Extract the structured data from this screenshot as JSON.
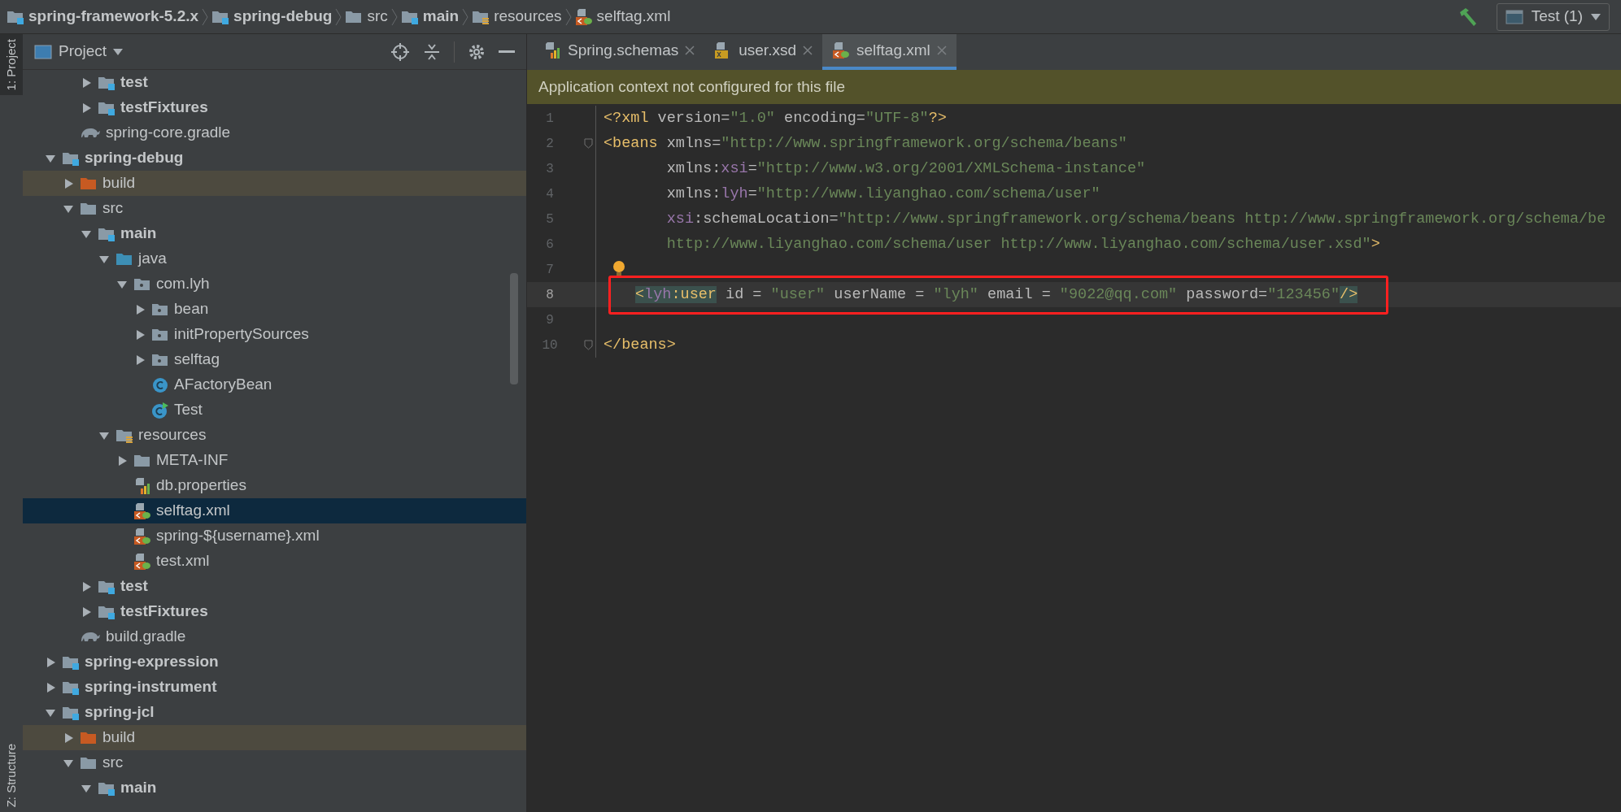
{
  "breadcrumbs": [
    {
      "label": "spring-framework-5.2.x",
      "kind": "module"
    },
    {
      "label": "spring-debug",
      "kind": "module"
    },
    {
      "label": "src",
      "kind": "folder"
    },
    {
      "label": "main",
      "kind": "module"
    },
    {
      "label": "resources",
      "kind": "resources"
    },
    {
      "label": "selftag.xml",
      "kind": "xml-spring"
    }
  ],
  "run_config": {
    "label": "Test (1)"
  },
  "side_tabs": [
    {
      "label": "1: Project",
      "selected": true
    },
    {
      "label": "Z: Structure",
      "selected": false
    }
  ],
  "project_panel": {
    "title": "Project"
  },
  "tree": [
    {
      "kind": "offscreen",
      "children": [
        {
          "kind": "offscreen",
          "children": [
            {
              "label": "test",
              "kind": "module",
              "expanded": false,
              "selected": false
            },
            {
              "label": "testFixtures",
              "kind": "module",
              "expanded": false,
              "selected": false
            }
          ]
        },
        {
          "label": "spring-core.gradle",
          "kind": "gradle",
          "selected": false
        }
      ]
    },
    {
      "label": "spring-debug",
      "kind": "module",
      "expanded": true,
      "selected": false,
      "children": [
        {
          "label": "build",
          "kind": "excluded",
          "expanded": false,
          "selected": false
        },
        {
          "label": "src",
          "kind": "folder",
          "expanded": true,
          "selected": false,
          "children": [
            {
              "label": "main",
              "kind": "module",
              "expanded": true,
              "selected": false,
              "children": [
                {
                  "label": "java",
                  "kind": "source",
                  "expanded": true,
                  "selected": false,
                  "children": [
                    {
                      "label": "com.lyh",
                      "kind": "package",
                      "expanded": true,
                      "selected": false,
                      "children": [
                        {
                          "label": "bean",
                          "kind": "package",
                          "expanded": false,
                          "selected": false
                        },
                        {
                          "label": "initPropertySources",
                          "kind": "package",
                          "expanded": false,
                          "selected": false
                        },
                        {
                          "label": "selftag",
                          "kind": "package",
                          "expanded": false,
                          "selected": false
                        },
                        {
                          "label": "AFactoryBean",
                          "kind": "class",
                          "selected": false
                        },
                        {
                          "label": "Test",
                          "kind": "test-class",
                          "selected": false
                        }
                      ]
                    }
                  ]
                },
                {
                  "label": "resources",
                  "kind": "resources",
                  "expanded": true,
                  "selected": false,
                  "children": [
                    {
                      "label": "META-INF",
                      "kind": "folder",
                      "expanded": false,
                      "selected": false
                    },
                    {
                      "label": "db.properties",
                      "kind": "properties",
                      "selected": false
                    },
                    {
                      "label": "selftag.xml",
                      "kind": "xml-spring",
                      "selected": true
                    },
                    {
                      "label": "spring-${username}.xml",
                      "kind": "xml-spring",
                      "selected": false
                    },
                    {
                      "label": "test.xml",
                      "kind": "xml-spring",
                      "selected": false
                    }
                  ]
                }
              ]
            },
            {
              "label": "test",
              "kind": "module",
              "expanded": false,
              "selected": false
            },
            {
              "label": "testFixtures",
              "kind": "module",
              "expanded": false,
              "selected": false
            }
          ]
        },
        {
          "label": "build.gradle",
          "kind": "gradle",
          "selected": false
        }
      ]
    },
    {
      "label": "spring-expression",
      "kind": "module",
      "expanded": false,
      "selected": false
    },
    {
      "label": "spring-instrument",
      "kind": "module",
      "expanded": false,
      "selected": false
    },
    {
      "label": "spring-jcl",
      "kind": "module",
      "expanded": true,
      "selected": false,
      "children": [
        {
          "label": "build",
          "kind": "excluded",
          "expanded": false,
          "selected": false
        },
        {
          "label": "src",
          "kind": "folder",
          "expanded": true,
          "selected": false,
          "children": [
            {
              "label": "main",
              "kind": "module",
              "expanded": true,
              "selected": false
            }
          ]
        }
      ]
    }
  ],
  "editor_tabs": [
    {
      "label": "Spring.schemas",
      "kind": "properties",
      "selected": false
    },
    {
      "label": "user.xsd",
      "kind": "xsd",
      "selected": false
    },
    {
      "label": "selftag.xml",
      "kind": "xml-spring",
      "selected": true
    }
  ],
  "notification": "Application context not configured for this file",
  "code_lines": [
    {
      "number": "1",
      "tokens": [
        {
          "kind": "tag",
          "text": "<?xml"
        },
        {
          "kind": "attr",
          "text": " version="
        },
        {
          "kind": "value",
          "text": "\"1.0\""
        },
        {
          "kind": "attr",
          "text": " encoding="
        },
        {
          "kind": "value",
          "text": "\"UTF-8\""
        },
        {
          "kind": "tag",
          "text": "?>"
        }
      ]
    },
    {
      "number": "2",
      "fold": true,
      "tokens": [
        {
          "kind": "tag",
          "text": "<beans"
        },
        {
          "kind": "attr",
          "text": " xmlns="
        },
        {
          "kind": "value",
          "text": "\"http://www.springframework.org/schema/beans\""
        }
      ]
    },
    {
      "number": "3",
      "tokens": [
        {
          "kind": "attr",
          "text": "       xmlns:"
        },
        {
          "kind": "ns",
          "text": "xsi"
        },
        {
          "kind": "attr",
          "text": "="
        },
        {
          "kind": "value",
          "text": "\"http://www.w3.org/2001/XMLSchema-instance\""
        }
      ]
    },
    {
      "number": "4",
      "tokens": [
        {
          "kind": "attr",
          "text": "       xmlns:"
        },
        {
          "kind": "ns",
          "text": "lyh"
        },
        {
          "kind": "attr",
          "text": "="
        },
        {
          "kind": "value",
          "text": "\"http://www.liyanghao.com/schema/user\""
        }
      ]
    },
    {
      "number": "5",
      "tokens": [
        {
          "kind": "ns",
          "text": "       xsi"
        },
        {
          "kind": "attr",
          "text": ":schemaLocation="
        },
        {
          "kind": "value",
          "text": "\"http://www.springframework.org/schema/beans http://www.springframework.org/schema/be"
        }
      ]
    },
    {
      "number": "6",
      "tokens": [
        {
          "kind": "value",
          "text": "       http://www.liyanghao.com/schema/user http://www.liyanghao.com/schema/user.xsd\""
        },
        {
          "kind": "tag",
          "text": ">"
        }
      ]
    },
    {
      "number": "7",
      "bulb": true
    },
    {
      "number": "8",
      "current": true,
      "outlined": true,
      "tokens": [
        {
          "kind": "tag",
          "text": "<",
          "matched": true
        },
        {
          "kind": "ns",
          "text": "lyh",
          "matched": true
        },
        {
          "kind": "tag",
          "text": ":user",
          "matched": true
        },
        {
          "kind": "attr",
          "text": " id = "
        },
        {
          "kind": "value",
          "text": "\"user\""
        },
        {
          "kind": "attr",
          "text": " userName = "
        },
        {
          "kind": "value",
          "text": "\"lyh\""
        },
        {
          "kind": "attr",
          "text": " email = "
        },
        {
          "kind": "value",
          "text": "\"9022@qq.com\""
        },
        {
          "kind": "attr",
          "text": " password="
        },
        {
          "kind": "value",
          "text": "\"123456\""
        },
        {
          "kind": "tag",
          "text": "/>",
          "matched": true
        }
      ]
    },
    {
      "number": "9"
    },
    {
      "number": "10",
      "fold": true,
      "tokens": [
        {
          "kind": "tag",
          "text": "</beans>"
        }
      ]
    }
  ]
}
